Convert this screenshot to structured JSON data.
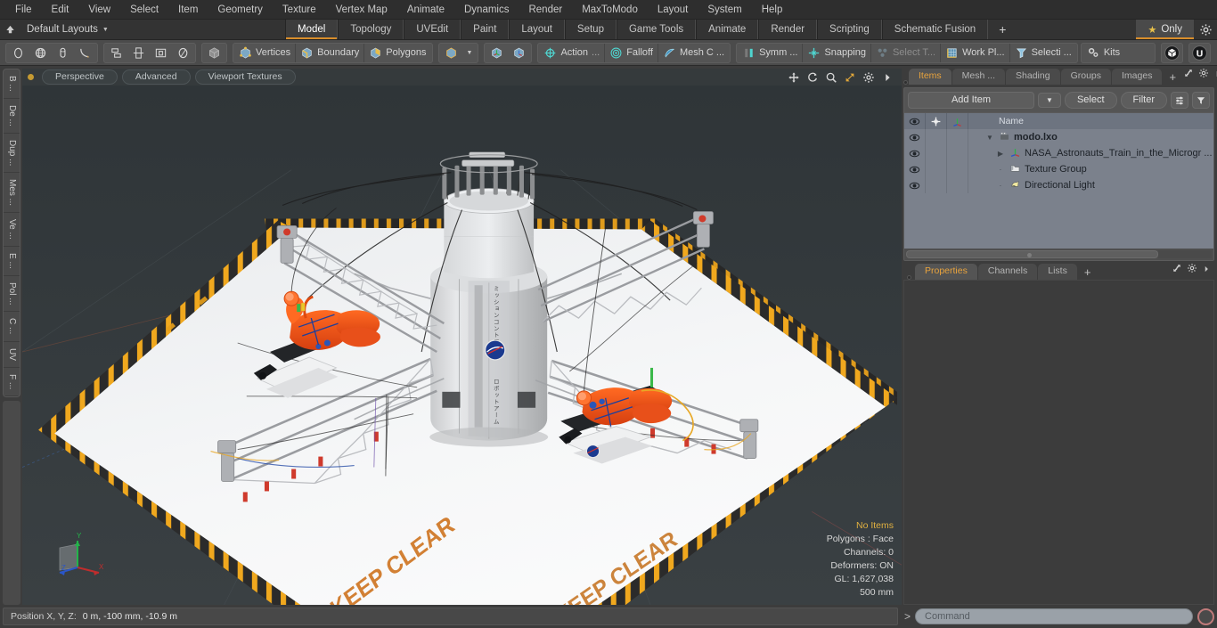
{
  "menubar": {
    "items": [
      "File",
      "Edit",
      "View",
      "Select",
      "Item",
      "Geometry",
      "Texture",
      "Vertex Map",
      "Animate",
      "Dynamics",
      "Render",
      "MaxToModo",
      "Layout",
      "System",
      "Help"
    ]
  },
  "layout_row": {
    "up_arrow_icon": "up-arrow-icon",
    "layouts_label": "Default Layouts",
    "caret_icon": "chevron-down-icon",
    "tabs": [
      {
        "label": "Model",
        "active": true
      },
      {
        "label": "Topology",
        "active": false
      },
      {
        "label": "UVEdit",
        "active": false
      },
      {
        "label": "Paint",
        "active": false
      },
      {
        "label": "Layout",
        "active": false
      },
      {
        "label": "Setup",
        "active": false
      },
      {
        "label": "Game Tools",
        "active": false
      },
      {
        "label": "Animate",
        "active": false
      },
      {
        "label": "Render",
        "active": false
      },
      {
        "label": "Scripting",
        "active": false
      },
      {
        "label": "Schematic Fusion",
        "active": false
      }
    ],
    "add_tab_label": "+",
    "only_label": "Only",
    "star_icon": "star-icon",
    "gear_icon": "gear-icon"
  },
  "toolbar": {
    "shape_tools": [
      {
        "name": "ellipse-tool",
        "icon": "ellipse-icon"
      },
      {
        "name": "sphere-tool",
        "icon": "globe-icon"
      },
      {
        "name": "capsule-tool",
        "icon": "capsule-icon"
      },
      {
        "name": "curve-tool",
        "icon": "curve-icon"
      }
    ],
    "arrange_tools": [
      {
        "name": "align-tool",
        "icon": "align-icon"
      },
      {
        "name": "center-tool",
        "icon": "center-icon"
      },
      {
        "name": "bound-tool",
        "icon": "bound-icon"
      },
      {
        "name": "radial-tool",
        "icon": "radial-icon"
      }
    ],
    "mode_cube": {
      "name": "item-mode",
      "icon": "cube-icon"
    },
    "selection_modes": [
      {
        "label": "Vertices",
        "icon": "vertices-icon"
      },
      {
        "label": "Boundary",
        "icon": "boundary-icon"
      },
      {
        "label": "Polygons",
        "icon": "polygons-icon"
      }
    ],
    "mode_dropdown": {
      "icon": "cube-icon",
      "caret": "chevron-down-icon"
    },
    "center_tools": [
      {
        "name": "center-pivot-tool",
        "icon": "pivot-icon"
      },
      {
        "name": "center-axis-tool",
        "icon": "axis-icon"
      }
    ],
    "action_center": {
      "label": "Action",
      "ellipsis": "...",
      "icon": "action-center-icon"
    },
    "falloff": {
      "label": "Falloff",
      "icon": "falloff-icon"
    },
    "mesh_constraint": {
      "label": "Mesh C ...",
      "icon": "mesh-constraint-icon"
    },
    "symmetry": {
      "label": "Symm ...",
      "icon": "symmetry-icon"
    },
    "snapping": {
      "label": "Snapping",
      "icon": "snapping-icon"
    },
    "select_through": {
      "label": "Select T...",
      "icon": "select-through-icon",
      "disabled": true
    },
    "work_plane": {
      "label": "Work Pl...",
      "icon": "work-plane-icon"
    },
    "selection_set": {
      "label": "Selecti ...",
      "icon": "selection-icon"
    },
    "kits": {
      "label": "Kits",
      "icon": "kits-icon"
    },
    "modo_badge": {
      "name": "modo-icon"
    },
    "unreal_badge": {
      "name": "unreal-icon"
    }
  },
  "left_tabs": [
    "B ...",
    "De ...",
    "Dup ...",
    "Mes ...",
    "Ve ...",
    "E ...",
    "Pol ...",
    "C ...",
    "UV",
    "F ..."
  ],
  "viewport": {
    "dot_icon": "active-dot-icon",
    "pills": [
      "Perspective",
      "Advanced",
      "Viewport Textures"
    ],
    "right_icons": [
      "move-icon",
      "rotate-icon",
      "zoom-icon",
      "fit-icon",
      "gear-icon",
      "chevron-right-icon"
    ],
    "floor_text": "KEEP CLEAR",
    "stats": {
      "selection": "No Items",
      "polygons": "Polygons : Face",
      "channels": "Channels: 0",
      "deformers": "Deformers: ON",
      "gl": "GL: 1,627,038",
      "grid": "500 mm"
    },
    "gizmo": {
      "x": "X",
      "y": "Y",
      "z": "Z"
    }
  },
  "right_panel": {
    "tabs": [
      {
        "label": "Items",
        "active": true
      },
      {
        "label": "Mesh ...",
        "active": false
      },
      {
        "label": "Shading",
        "active": false
      },
      {
        "label": "Groups",
        "active": false
      },
      {
        "label": "Images",
        "active": false
      }
    ],
    "add_tab_label": "+",
    "tab_icons": [
      "expand-icon",
      "gear-icon",
      "chevron-right-icon"
    ],
    "add_item_label": "Add Item",
    "add_item_caret": "chevron-down-icon",
    "select_label": "Select",
    "filter_label": "Filter",
    "list_icon": "list-options-icon",
    "funnel_icon": "funnel-icon",
    "tree_columns": {
      "eye": "eye-icon",
      "lock": "crosshair-icon",
      "axis": "axis-icon",
      "name": "Name"
    },
    "tree_rows": [
      {
        "label": "modo.lxo",
        "icon": "scene-icon",
        "depth": 0,
        "twisty": "down",
        "bold": true
      },
      {
        "label": "NASA_Astronauts_Train_in_the_Microgr ...",
        "icon": "mesh-icon",
        "depth": 1,
        "twisty": "right",
        "bold": false
      },
      {
        "label": "Texture Group",
        "icon": "folder-icon",
        "depth": 1,
        "twisty": "none",
        "bold": false
      },
      {
        "label": "Directional Light",
        "icon": "light-icon",
        "depth": 1,
        "twisty": "none",
        "bold": false
      }
    ],
    "properties_tabs": [
      {
        "label": "Properties",
        "active": true
      },
      {
        "label": "Channels",
        "active": false
      },
      {
        "label": "Lists",
        "active": false
      }
    ],
    "properties_add_label": "+",
    "properties_icons": [
      "expand-icon",
      "gear-icon",
      "chevron-right-icon"
    ]
  },
  "footer": {
    "position_label": "Position X, Y, Z:",
    "position_value": "0 m, -100 mm, -10.9 m",
    "command_prompt": ">",
    "command_placeholder": "Command",
    "command_value": "",
    "record_icon": "record-icon"
  },
  "colors": {
    "accent_orange": "#d98e2b",
    "tab_orange": "#e8a33d",
    "panel_bg": "#3c3c3c",
    "toolbar_bg": "#4b4b4b",
    "tree_bg": "#7b818c",
    "viewport_bg": "#343a3c",
    "teal_icon": "#4fd4cf",
    "status_highlight": "#e0b040"
  }
}
